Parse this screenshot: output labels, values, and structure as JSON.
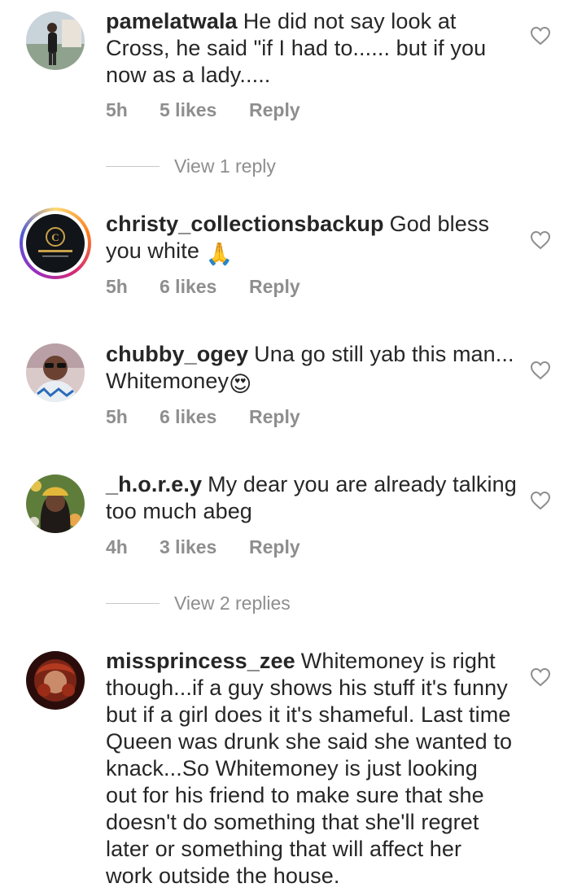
{
  "comments": [
    {
      "username": "pamelatwala",
      "text": "He did not say look at Cross, he said \"if I had to...... but if you now as a lady.....",
      "time": "5h",
      "likes": "5 likes",
      "reply": "Reply"
    },
    {
      "username": "christy_collectionsbackup",
      "text": "God bless you white",
      "emoji": "🙏",
      "time": "5h",
      "likes": "6 likes",
      "reply": "Reply"
    },
    {
      "username": "chubby_ogey",
      "text": "Una go still yab this man... Whitemoney",
      "emoji": "😍",
      "time": "5h",
      "likes": "6 likes",
      "reply": "Reply"
    },
    {
      "username": "_h.o.r.e.y",
      "text": "My dear you are already talking too much abeg",
      "time": "4h",
      "likes": "3 likes",
      "reply": "Reply"
    },
    {
      "username": "missprincess_zee",
      "text": "Whitemoney is right though...if a guy shows his stuff it's funny but if a girl does it it's shameful. Last time Queen was drunk she said she wanted to knack...So Whitemoney is just looking out for his friend to make sure that she doesn't do something that she'll regret later or something that will affect her work outside the house."
    }
  ],
  "view_replies": [
    "View 1 reply",
    "View 2 replies"
  ],
  "icons": {
    "like": "heart-outline-icon",
    "story_ring": "story-ring"
  },
  "colors": {
    "text": "#262626",
    "secondary": "#8e8e8e",
    "divider": "#c7c7c7"
  }
}
